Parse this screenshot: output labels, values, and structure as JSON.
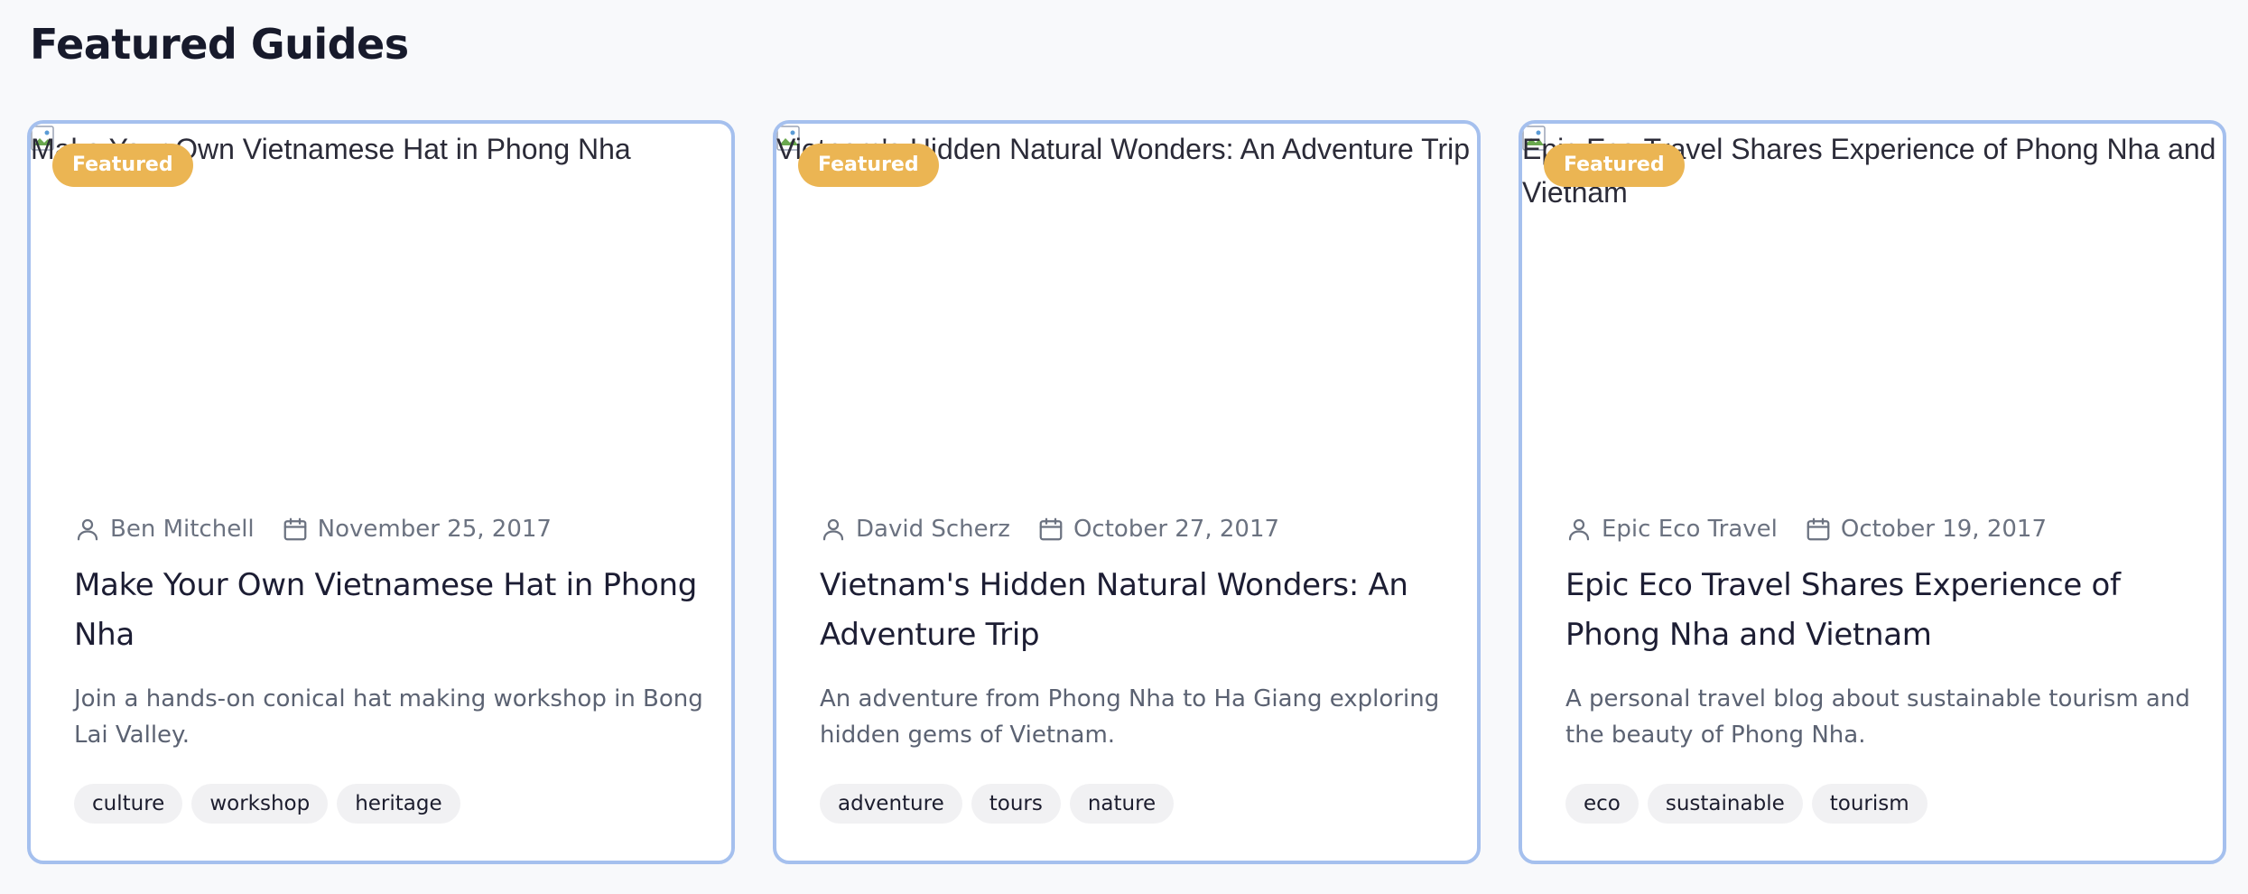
{
  "section": {
    "title": "Featured Guides"
  },
  "cards": [
    {
      "image_alt": "Make Your Own Vietnamese Hat in Phong Nha",
      "badge": "Featured",
      "author": "Ben Mitchell",
      "date": "November 25, 2017",
      "title": "Make Your Own Vietnamese Hat in Phong Nha",
      "description": "Join a hands-on conical hat making workshop in Bong Lai Valley.",
      "tags": [
        "culture",
        "workshop",
        "heritage"
      ]
    },
    {
      "image_alt": "Vietnam's Hidden Natural Wonders: An Adventure Trip",
      "badge": "Featured",
      "author": "David Scherz",
      "date": "October 27, 2017",
      "title": "Vietnam's Hidden Natural Wonders: An Adventure Trip",
      "description": "An adventure from Phong Nha to Ha Giang exploring hidden gems of Vietnam.",
      "tags": [
        "adventure",
        "tours",
        "nature"
      ]
    },
    {
      "image_alt": "Epic Eco Travel Shares Experience of Phong Nha and Vietnam",
      "badge": "Featured",
      "author": "Epic Eco Travel",
      "date": "October 19, 2017",
      "title": "Epic Eco Travel Shares Experience of Phong Nha and Vietnam",
      "description": "A personal travel blog about sustainable tourism and the beauty of Phong Nha.",
      "tags": [
        "eco",
        "sustainable",
        "tourism"
      ]
    }
  ],
  "colors": {
    "background": "#f8f9fb",
    "card_border": "#a5c0ee",
    "badge": "#ebb553",
    "tag_bg": "#f1f1f3",
    "title_text": "#1c1d33",
    "muted_text": "#6b7280"
  },
  "icons": {
    "author": "user-icon",
    "date": "calendar-icon",
    "image": "broken-image-icon"
  }
}
